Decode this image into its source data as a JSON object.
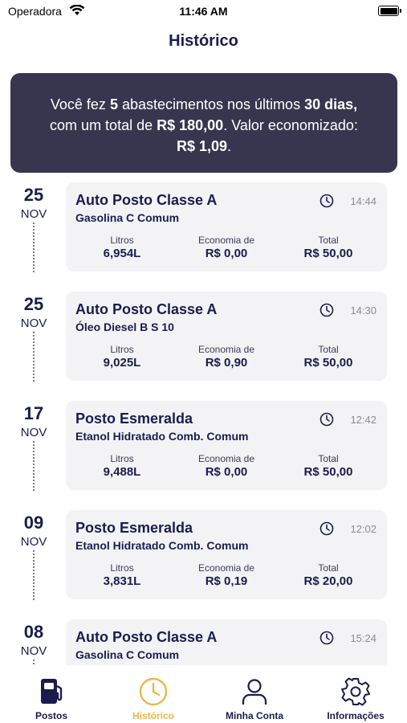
{
  "status_bar": {
    "carrier": "Operadora",
    "time": "11:46 AM"
  },
  "header": {
    "title": "Histórico"
  },
  "summary": {
    "t1": "Você fez ",
    "count": "5",
    "t2": " abastecimentos nos últimos ",
    "days": "30 dias,",
    "t3": " com um total de ",
    "total": "R$ 180,00",
    "t4": ". Valor economizado: ",
    "saved": "R$ 1,09",
    "t5": "."
  },
  "labels": {
    "liters": "Litros",
    "savings": "Economia de",
    "total": "Total"
  },
  "entries": [
    {
      "day": "25",
      "month": "NOV",
      "station": "Auto Posto Classe A",
      "fuel": "Gasolina C Comum",
      "time": "14:44",
      "liters": "6,954L",
      "savings": "R$ 0,00",
      "total": "R$ 50,00"
    },
    {
      "day": "25",
      "month": "NOV",
      "station": "Auto Posto Classe A",
      "fuel": "Óleo Diesel B S 10",
      "time": "14:30",
      "liters": "9,025L",
      "savings": "R$ 0,90",
      "total": "R$ 50,00"
    },
    {
      "day": "17",
      "month": "NOV",
      "station": "Posto Esmeralda",
      "fuel": "Etanol Hidratado Comb. Comum",
      "time": "12:42",
      "liters": "9,488L",
      "savings": "R$ 0,00",
      "total": "R$ 50,00"
    },
    {
      "day": "09",
      "month": "NOV",
      "station": "Posto Esmeralda",
      "fuel": "Etanol Hidratado Comb. Comum",
      "time": "12:02",
      "liters": "3,831L",
      "savings": "R$ 0,19",
      "total": "R$ 20,00"
    },
    {
      "day": "08",
      "month": "NOV",
      "station": "Auto Posto Classe A",
      "fuel": "Gasolina C Comum",
      "time": "15:24",
      "liters": "",
      "savings": "",
      "total": ""
    }
  ],
  "tabs": [
    {
      "label": "Postos",
      "icon": "fuel-pump-icon"
    },
    {
      "label": "Histórico",
      "icon": "clock-icon",
      "active": true
    },
    {
      "label": "Minha Conta",
      "icon": "user-icon"
    },
    {
      "label": "Informações",
      "icon": "gear-icon"
    }
  ],
  "colors": {
    "primary": "#1b1c4d",
    "accent": "#e9b64c",
    "summary_bg": "#38364f",
    "card_bg": "#f3f3f6"
  }
}
